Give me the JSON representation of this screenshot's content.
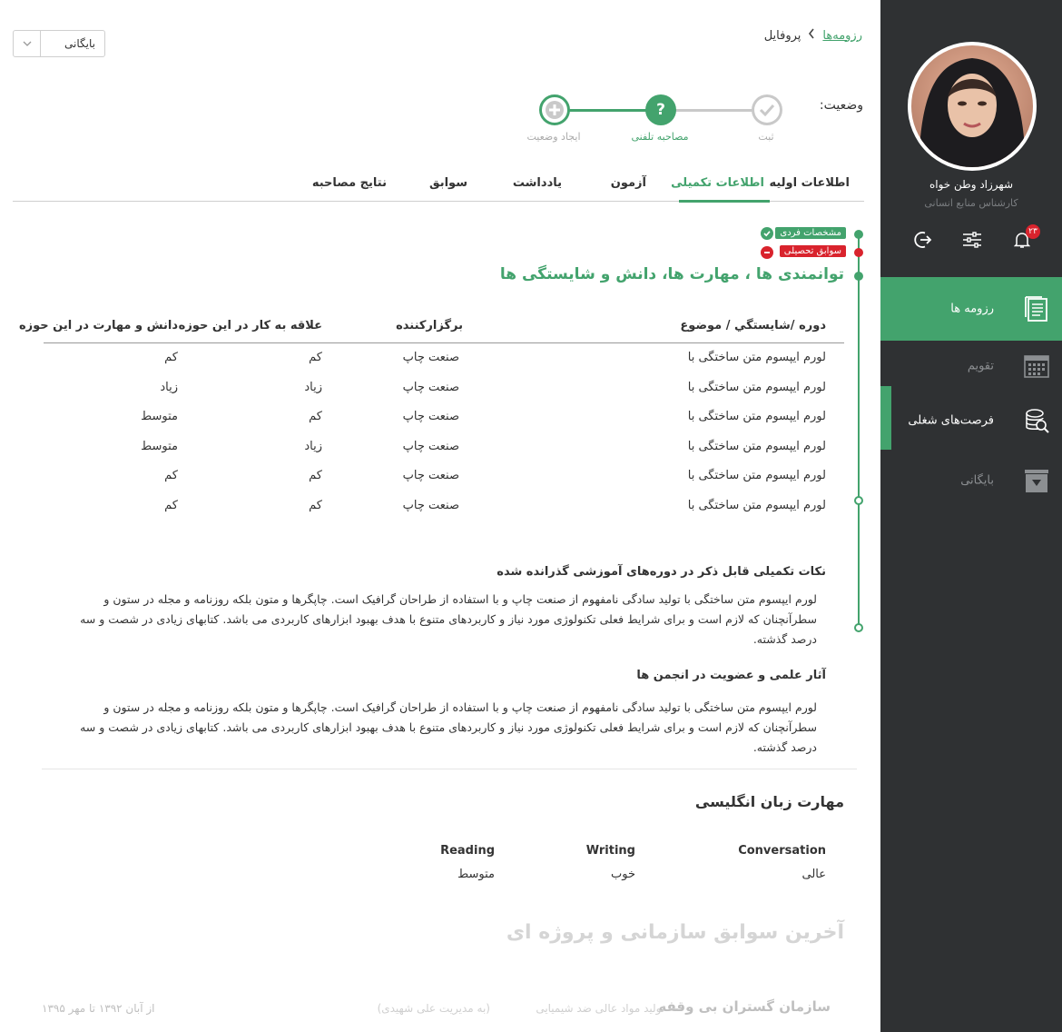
{
  "breadcrumb": {
    "root": "رزومه‌ها",
    "current": "پروفایل"
  },
  "archive_select": {
    "value": "بایگانی"
  },
  "status": {
    "label": "وضعیت:",
    "steps": [
      {
        "label": "ثبت",
        "state": "done"
      },
      {
        "label": "مصاحبه تلفنی",
        "state": "current"
      },
      {
        "label": "ایجاد وضعیت",
        "state": "add"
      }
    ]
  },
  "tabs": [
    {
      "label": "اطلاعات اولیه"
    },
    {
      "label": "اطلاعات تکمیلی",
      "active": true
    },
    {
      "label": "آزمون"
    },
    {
      "label": "یادداشت"
    },
    {
      "label": "سوابق"
    },
    {
      "label": "نتایج مصاحبه"
    }
  ],
  "timeline_tags": [
    {
      "label": "مشخصات فردی",
      "status": "complete"
    },
    {
      "label": "سوابق تحصیلی",
      "status": "incomplete"
    }
  ],
  "section_title": "توانمندی ها ، مهارت ها، دانش و شایستگی ها",
  "skills_table": {
    "headers": [
      "دوره /شایستگي / موضوع",
      "برگزارکننده",
      "علاقه به کار در این حوزه",
      "دانش و مهارت در این حوزه"
    ],
    "rows": [
      [
        "لورم ایپسوم متن ساختگی با",
        "صنعت چاپ",
        "کم",
        "کم"
      ],
      [
        "لورم ایپسوم متن ساختگی با",
        "صنعت چاپ",
        "زیاد",
        "زیاد"
      ],
      [
        "لورم ایپسوم متن ساختگی با",
        "صنعت چاپ",
        "کم",
        "متوسط"
      ],
      [
        "لورم ایپسوم متن ساختگی با",
        "صنعت چاپ",
        "زیاد",
        "متوسط"
      ],
      [
        "لورم ایپسوم متن ساختگی با",
        "صنعت چاپ",
        "کم",
        "کم"
      ],
      [
        "لورم ایپسوم متن ساختگی با",
        "صنعت چاپ",
        "کم",
        "کم"
      ]
    ]
  },
  "notes": [
    {
      "title": "نکات تکمیلی قابل ذکر در دوره‌های آموزشی گذرانده شده",
      "body": "لورم ایپسوم متن ساختگی با تولید سادگی نامفهوم از صنعت چاپ و با استفاده از طراحان گرافیک است. چاپگرها و متون بلکه روزنامه و مجله در ستون و سطرآنچنان که لازم است و برای شرایط فعلی تکنولوژی مورد نیاز و کاربردهای متنوع با هدف بهبود ابزارهای کاربردی می باشد. کتابهای زیادی در شصت و سه درصد گذشته."
    },
    {
      "title": "آثار علمی و عضویت در انجمن ها",
      "body": "لورم ایپسوم متن ساختگی با تولید سادگی نامفهوم از صنعت چاپ و با استفاده از طراحان گرافیک است. چاپگرها و متون بلکه روزنامه و مجله در ستون و سطرآنچنان که لازم است و برای شرایط فعلی تکنولوژی مورد نیاز و کاربردهای متنوع با هدف بهبود ابزارهای کاربردی می باشد. کتابهای زیادی در شصت و سه درصد گذشته."
    }
  ],
  "english": {
    "title": "مهارت زبان انگلیسی",
    "columns": [
      {
        "header": "Conversation",
        "value": "عالی"
      },
      {
        "header": "Writing",
        "value": "خوب"
      },
      {
        "header": "Reading",
        "value": "متوسط"
      }
    ]
  },
  "history": {
    "title": "آخرین سوابق سازمانی و پروژه ای",
    "org": "سازمان گستران بی وقفه",
    "field": "— تولید مواد عالی ضد شیمیایی",
    "manager": "(به مدیریت علی شهیدی)",
    "date": "از آبان ۱۳۹۲ تا مهر ۱۳۹۵"
  },
  "user": {
    "name": "شهرزاد  وطن خواه",
    "role": "کارشناس منابع انسانی",
    "notification_count": "۲۳"
  },
  "nav": [
    {
      "label": "رزومه ها",
      "icon": "resume-icon",
      "state": "active"
    },
    {
      "label": "تقویم",
      "icon": "calendar-icon",
      "state": "muted"
    },
    {
      "label": "فرصت‌های شغلی",
      "icon": "job-search-icon",
      "state": "bright"
    },
    {
      "label": "بایگانی",
      "icon": "archive-icon",
      "state": "muted"
    }
  ],
  "colors": {
    "accent": "#43a36d",
    "sidebar": "#2f3133",
    "danger": "#d9232d"
  }
}
